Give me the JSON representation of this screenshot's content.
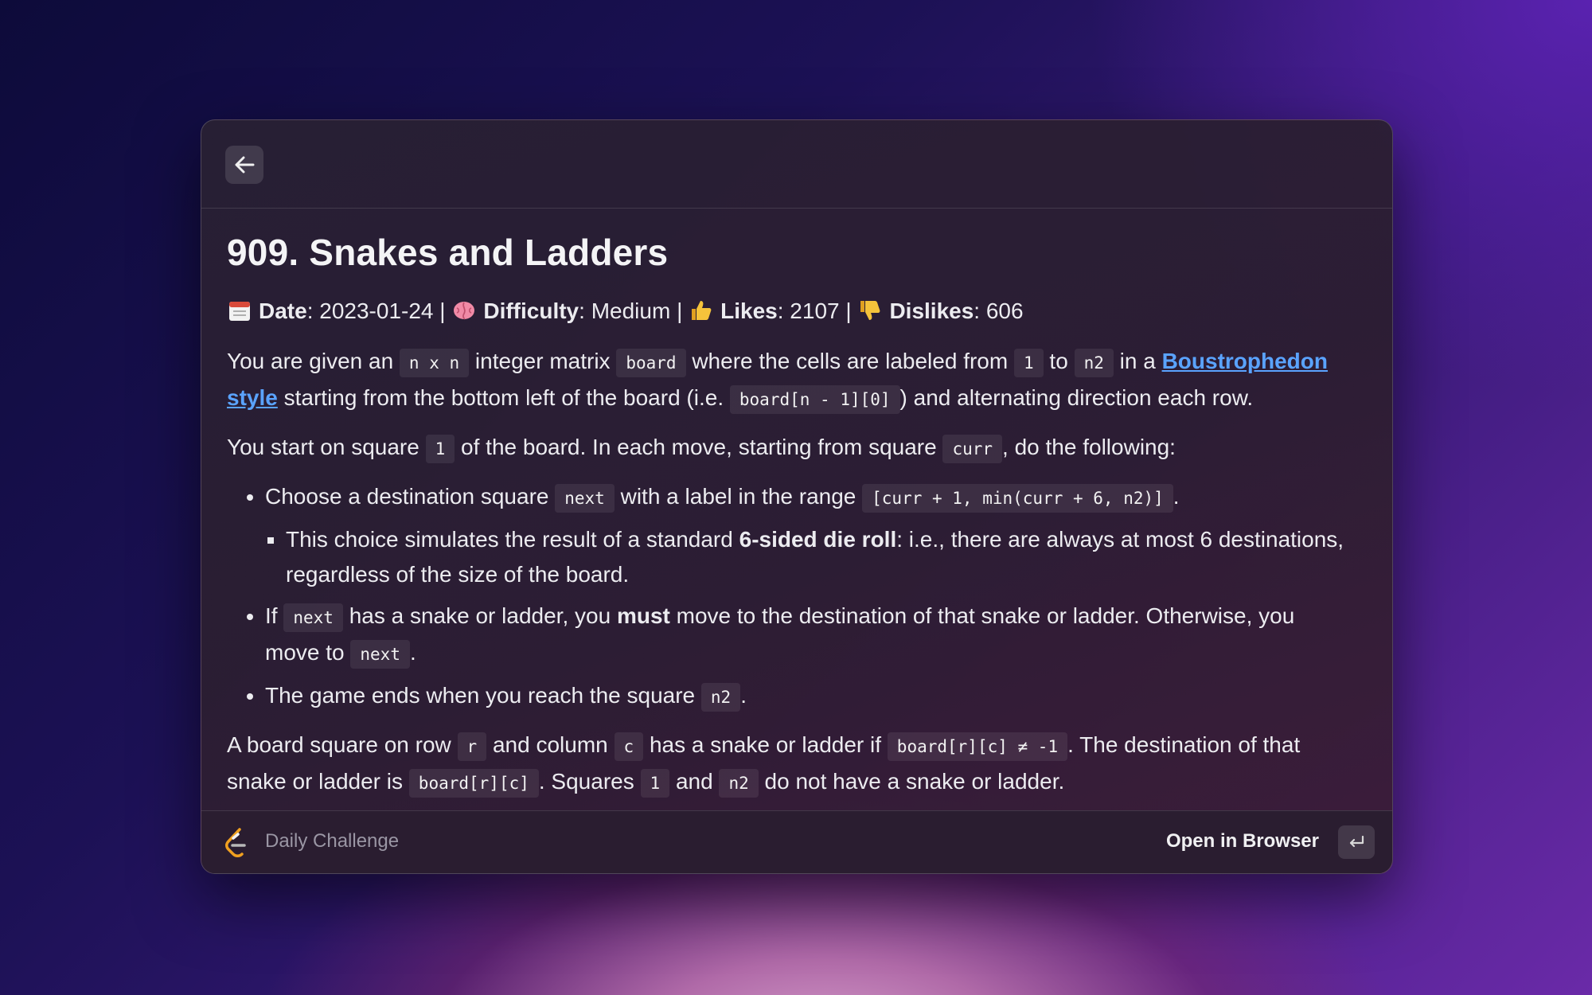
{
  "window": {
    "back_icon": "arrow-left-icon",
    "title": "909. Snakes and Ladders",
    "meta": {
      "date_label": "Date",
      "date_value": "2023-01-24",
      "difficulty_label": "Difficulty",
      "difficulty_value": "Medium",
      "likes_label": "Likes",
      "likes_value": "2107",
      "dislikes_label": "Dislikes",
      "dislikes_value": "606",
      "sep": "|",
      "icons": [
        "calendar-icon",
        "brain-icon",
        "thumbs-up-icon",
        "thumbs-down-icon"
      ]
    },
    "para1": {
      "t1": "You are given an",
      "c1": "n x n",
      "t2": "integer matrix",
      "c2": "board",
      "t3": "where the cells are labeled from",
      "c3": "1",
      "t4": "to",
      "c4": "n2",
      "t5": "in a",
      "link": "Boustrophedon style",
      "t6": "starting from the bottom left of the board (i.e.",
      "c5": "board[n - 1][0]",
      "t7": ") and alternating direction each row."
    },
    "para2": {
      "t1": "You start on square",
      "c1": "1",
      "t2": "of the board. In each move, starting from square",
      "c2": "curr",
      "t3": ", do the following:"
    },
    "list": {
      "item1": {
        "t1": "Choose a destination square",
        "c1": "next",
        "t2": "with a label in the range",
        "c2": "[curr + 1, min(curr + 6, n2)]",
        "t3": ".",
        "sub_t1": "This choice simulates the result of a standard",
        "sub_bold": "6-sided die roll",
        "sub_t2": ": i.e., there are always at most 6 destinations, regardless of the size of the board."
      },
      "item2": {
        "t1": "If",
        "c1": "next",
        "t2": "has a snake or ladder, you",
        "bold": "must",
        "t3": "move to the destination of that snake or ladder. Otherwise, you move to",
        "c2": "next",
        "t4": "."
      },
      "item3": {
        "t1": "The game ends when you reach the square",
        "c1": "n2",
        "t2": "."
      }
    },
    "para3": {
      "t1": "A board square on row",
      "c1": "r",
      "t2": "and column",
      "c2": "c",
      "t3": "has a snake or ladder if",
      "c3": "board[r][c] ≠ -1",
      "t4": ". The destination of that snake or ladder is",
      "c4": "board[r][c]",
      "t5": ". Squares",
      "c5": "1",
      "t6": "and",
      "c6": "n2",
      "t7": "do not have a snake or ladder."
    },
    "footer": {
      "logo_icon": "leetcode-logo-icon",
      "title": "Daily Challenge",
      "action_label": "Open in Browser",
      "enter_icon": "return-key-icon"
    }
  }
}
